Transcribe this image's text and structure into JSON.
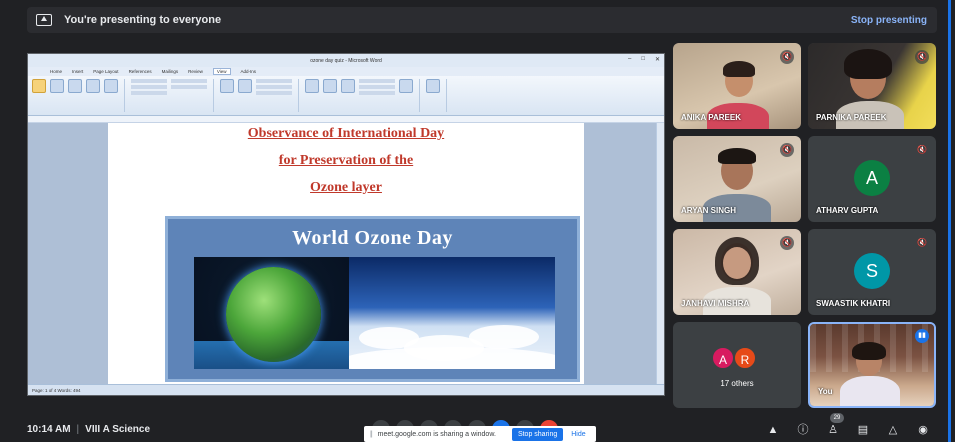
{
  "banner": {
    "text": "You're presenting to everyone",
    "stop_label": "Stop presenting"
  },
  "screen": {
    "window_title": "ozone day quiz - Microsoft Word",
    "ribbon_tabs": [
      "Home",
      "Insert",
      "Page Layout",
      "References",
      "Mailings",
      "Review",
      "View",
      "Add-Ins"
    ],
    "active_tab": "View",
    "status": "Page: 1 of 4    Words: 494",
    "doc_lines": [
      "Observance of International Day",
      "for Preservation of the",
      "Ozone layer"
    ],
    "poster_title": "World Ozone Day"
  },
  "participants": [
    {
      "name": "ANIKA PAREEK",
      "kind": "video",
      "muted": true
    },
    {
      "name": "PARNIKA PAREEK",
      "kind": "video",
      "muted": true
    },
    {
      "name": "ARYAN SINGH",
      "kind": "video",
      "muted": true
    },
    {
      "name": "ATHARV GUPTA",
      "kind": "avatar",
      "initial": "A",
      "color": "#0b8043",
      "muted": true
    },
    {
      "name": "JANHAVI MISHRA",
      "kind": "video",
      "muted": true
    },
    {
      "name": "SWAASTIK KHATRI",
      "kind": "avatar",
      "initial": "S",
      "color": "#0097a7",
      "muted": true
    }
  ],
  "others": {
    "initials": [
      "A",
      "R"
    ],
    "colors": [
      "#d81b60",
      "#e64a19"
    ],
    "label": "17 others"
  },
  "self_tile": {
    "name": "You"
  },
  "bottom": {
    "time": "10:14 AM",
    "meeting": "VIII A Science",
    "participant_count": "29",
    "share_notice": "meet.google.com is sharing a window.",
    "stop_sharing": "Stop sharing",
    "hide": "Hide"
  },
  "colors": {
    "accent": "#1a73e8",
    "background": "#202124",
    "tile": "#3c4043",
    "doc_heading": "#c0392b"
  }
}
